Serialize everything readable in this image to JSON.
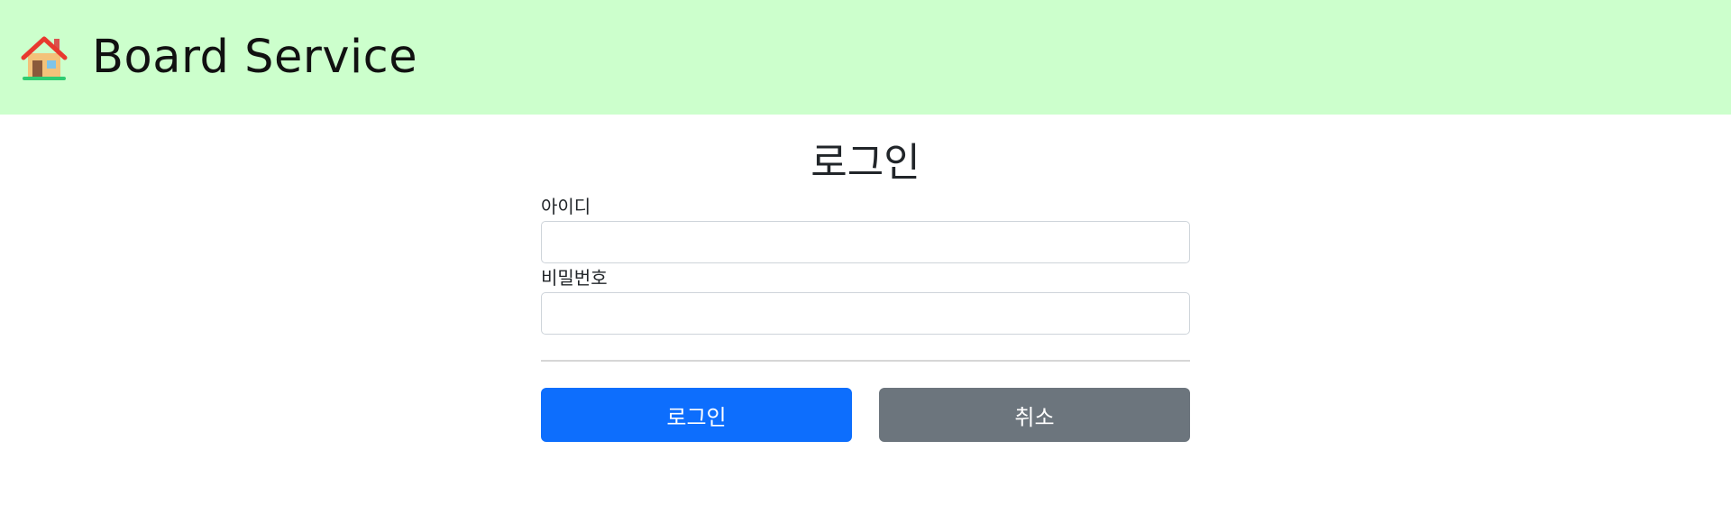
{
  "header": {
    "brand": "Board Service",
    "logo_icon": "house-icon",
    "background": "#ccffcc"
  },
  "login": {
    "title": "로그인",
    "id_label": "아이디",
    "id_value": "",
    "password_label": "비밀번호",
    "password_value": "",
    "submit_label": "로그인",
    "cancel_label": "취소"
  },
  "colors": {
    "primary": "#0d6efd",
    "secondary": "#6c757d"
  }
}
